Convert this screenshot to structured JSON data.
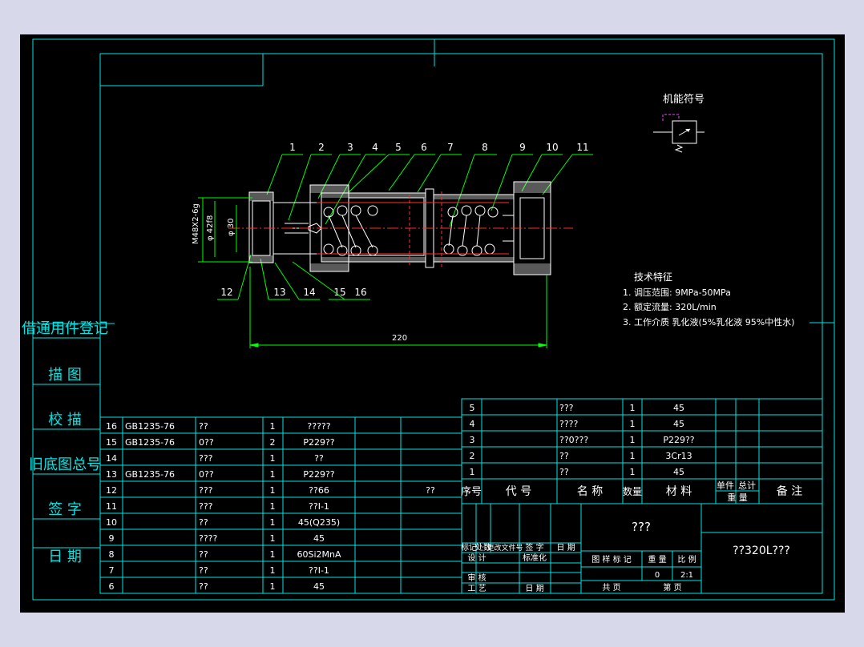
{
  "colors": {
    "frame": "#00e5e5",
    "line": "#ffffff",
    "part": "#ffffff",
    "leader": "#00ff00",
    "label": "#ffffff",
    "center": "#ff3030",
    "symbol": "#ff40ff",
    "background": "#000000"
  },
  "drawing": {
    "symbol_title": "机能符号",
    "part_numbers": [
      "1",
      "2",
      "3",
      "4",
      "5",
      "6",
      "7",
      "8",
      "9",
      "10",
      "11",
      "12",
      "13",
      "14",
      "15",
      "16"
    ],
    "dims": {
      "thread": "M48X2-6g",
      "dia_big": "φ 42f8",
      "dia_small": "φ 30",
      "length": "220"
    },
    "tech": {
      "title": "技术特征",
      "lines": [
        "1. 调压范围: 9MPa-50MPa",
        "2. 额定流量: 320L/min",
        "3. 工作介质 乳化液(5%乳化液 95%中性水)"
      ]
    }
  },
  "side_table": {
    "items": [
      "借通用件登记",
      "描 图",
      "校 描",
      "旧底图总号",
      "签 字",
      "日 期"
    ]
  },
  "bom_left": [
    {
      "no": "16",
      "code": "GB1235-76",
      "name": "??",
      "qty": "1",
      "material": "?????",
      "note": ""
    },
    {
      "no": "15",
      "code": "GB1235-76",
      "name": "0??",
      "qty": "2",
      "material": "P229??",
      "note": ""
    },
    {
      "no": "14",
      "code": "",
      "name": "???",
      "qty": "1",
      "material": "??",
      "note": ""
    },
    {
      "no": "13",
      "code": "GB1235-76",
      "name": "0??",
      "qty": "1",
      "material": "P229??",
      "note": ""
    },
    {
      "no": "12",
      "code": "",
      "name": "???",
      "qty": "1",
      "material": "??66",
      "note": "??"
    },
    {
      "no": "11",
      "code": "",
      "name": "???",
      "qty": "1",
      "material": "??I-1",
      "note": ""
    },
    {
      "no": "10",
      "code": "",
      "name": "??",
      "qty": "1",
      "material": "45(Q235)",
      "note": ""
    },
    {
      "no": "9",
      "code": "",
      "name": "????",
      "qty": "1",
      "material": "45",
      "note": ""
    },
    {
      "no": "8",
      "code": "",
      "name": "??",
      "qty": "1",
      "material": "60Si2MnA",
      "note": ""
    },
    {
      "no": "7",
      "code": "",
      "name": "??",
      "qty": "1",
      "material": "??I-1",
      "note": ""
    },
    {
      "no": "6",
      "code": "",
      "name": "??",
      "qty": "1",
      "material": "45",
      "note": ""
    }
  ],
  "bom_right": [
    {
      "no": "5",
      "name": "???",
      "qty": "1",
      "material": "45"
    },
    {
      "no": "4",
      "name": "????",
      "qty": "1",
      "material": "45"
    },
    {
      "no": "3",
      "name": "??0???",
      "qty": "1",
      "material": "P229??"
    },
    {
      "no": "2",
      "name": "??",
      "qty": "1",
      "material": "3Cr13"
    },
    {
      "no": "1",
      "name": "??",
      "qty": "1",
      "material": "45"
    }
  ],
  "bom_header": {
    "no": "序号",
    "code": "代 号",
    "name": "名 称",
    "qty": "数量",
    "material": "材 料",
    "unit": "单件",
    "total": "总计",
    "weight": "重 量",
    "note": "备 注"
  },
  "title_block": {
    "company": "???",
    "drawing_name": "??320L???",
    "rev_row": [
      "标记",
      "处数",
      "更改文件号",
      "签 字",
      "日 期"
    ],
    "design": "设 计",
    "std": "标准化",
    "check": "审 核",
    "process": "工 艺",
    "date": "日 期",
    "stage": "图 样 标 记",
    "weight_label": "重 量",
    "scale_label": "比 例",
    "weight_value": "0",
    "scale_value": "2:1",
    "total_sheets": "共  页",
    "sheet_no": "第  页"
  }
}
